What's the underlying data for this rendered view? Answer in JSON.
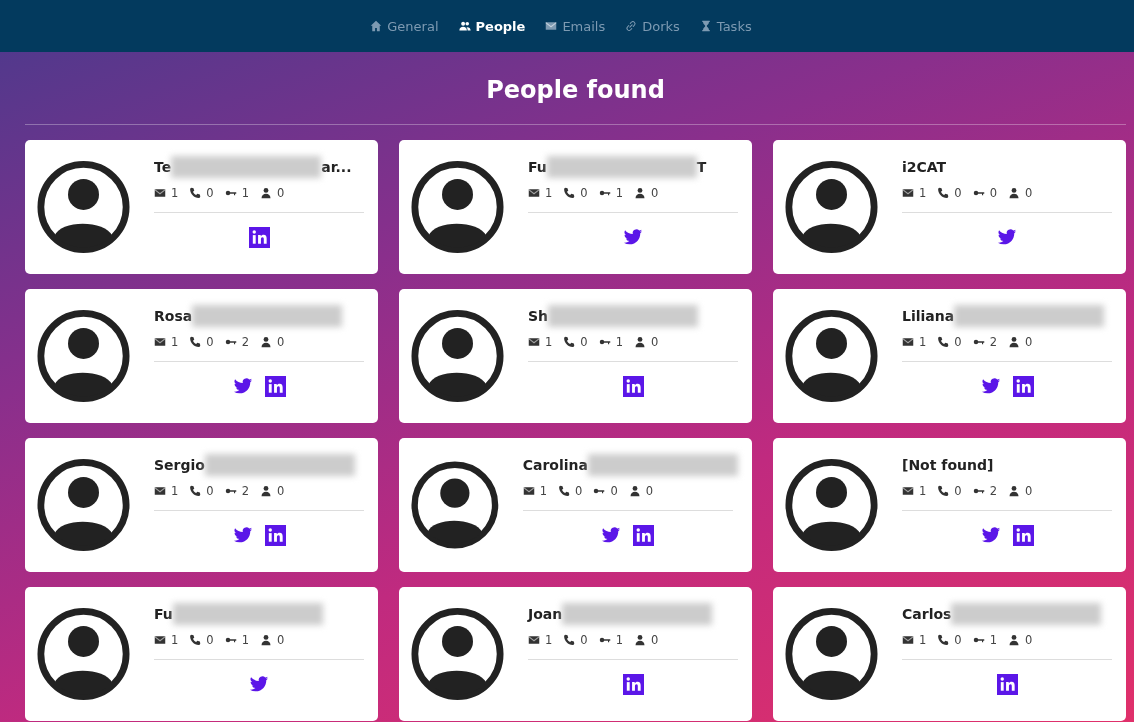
{
  "nav": [
    {
      "label": "General",
      "selected": false
    },
    {
      "label": "People",
      "selected": true
    },
    {
      "label": "Emails",
      "selected": false
    },
    {
      "label": "Dorks",
      "selected": false
    },
    {
      "label": "Tasks",
      "selected": false
    }
  ],
  "title": "People found",
  "people": [
    {
      "name": "Te",
      "name_end": "ar...",
      "redacted": true,
      "emails": "1",
      "phones": "0",
      "keys": "1",
      "accounts": "0",
      "socials": [
        {
          "kind": "linkedin"
        }
      ]
    },
    {
      "name": "Fu",
      "name_end": "T",
      "redacted": true,
      "emails": "1",
      "phones": "0",
      "keys": "1",
      "accounts": "0",
      "socials": [
        {
          "kind": "twitter"
        }
      ]
    },
    {
      "name": "i2CAT",
      "redacted": false,
      "emails": "1",
      "phones": "0",
      "keys": "0",
      "accounts": "0",
      "socials": [
        {
          "kind": "twitter"
        }
      ]
    },
    {
      "name": "Rosa",
      "redacted": true,
      "emails": "1",
      "phones": "0",
      "keys": "2",
      "accounts": "0",
      "socials": [
        {
          "kind": "twitter"
        },
        {
          "kind": "linkedin"
        }
      ]
    },
    {
      "name": "Sh",
      "redacted": true,
      "emails": "1",
      "phones": "0",
      "keys": "1",
      "accounts": "0",
      "socials": [
        {
          "kind": "linkedin"
        }
      ]
    },
    {
      "name": "Liliana",
      "redacted": true,
      "emails": "1",
      "phones": "0",
      "keys": "2",
      "accounts": "0",
      "socials": [
        {
          "kind": "twitter"
        },
        {
          "kind": "linkedin"
        }
      ]
    },
    {
      "name": "Sergio",
      "redacted": true,
      "emails": "1",
      "phones": "0",
      "keys": "2",
      "accounts": "0",
      "socials": [
        {
          "kind": "twitter"
        },
        {
          "kind": "linkedin"
        }
      ]
    },
    {
      "name": "Carolina",
      "redacted": true,
      "emails": "1",
      "phones": "0",
      "keys": "0",
      "accounts": "0",
      "socials": [
        {
          "kind": "twitter"
        },
        {
          "kind": "linkedin"
        }
      ]
    },
    {
      "name": "[Not found]",
      "redacted": false,
      "emails": "1",
      "phones": "0",
      "keys": "2",
      "accounts": "0",
      "socials": [
        {
          "kind": "twitter"
        },
        {
          "kind": "linkedin"
        }
      ]
    },
    {
      "name": "Fu",
      "redacted": true,
      "emails": "1",
      "phones": "0",
      "keys": "1",
      "accounts": "0",
      "socials": [
        {
          "kind": "twitter"
        }
      ]
    },
    {
      "name": "Joan",
      "redacted": true,
      "emails": "1",
      "phones": "0",
      "keys": "1",
      "accounts": "0",
      "socials": [
        {
          "kind": "linkedin"
        }
      ]
    },
    {
      "name": "Carlos",
      "redacted": true,
      "emails": "1",
      "phones": "0",
      "keys": "1",
      "accounts": "0",
      "socials": [
        {
          "kind": "linkedin"
        }
      ]
    }
  ]
}
